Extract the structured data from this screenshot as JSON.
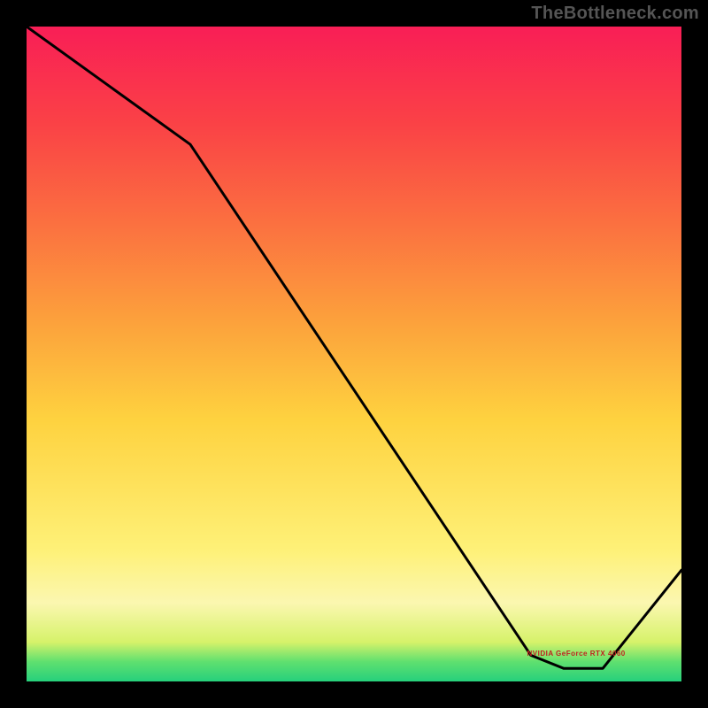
{
  "watermark": "TheBottleneck.com",
  "marker_label": "NVIDIA GeForce RTX 4060",
  "chart_data": {
    "type": "line",
    "title": "",
    "xlabel": "",
    "ylabel": "",
    "xlim": [
      0,
      100
    ],
    "ylim": [
      0,
      100
    ],
    "x": [
      0,
      25,
      77,
      82,
      88,
      100
    ],
    "values": [
      100,
      82,
      4,
      2,
      2,
      17
    ],
    "green_band_y": [
      0,
      3
    ],
    "yellow_white_band_y": [
      3,
      20
    ],
    "marker_x_range": [
      77,
      88
    ],
    "gradient_stops": [
      {
        "pct": 0,
        "color": "#26d07c"
      },
      {
        "pct": 3,
        "color": "#5fe06f"
      },
      {
        "pct": 6,
        "color": "#d6f26a"
      },
      {
        "pct": 12,
        "color": "#fbf7b0"
      },
      {
        "pct": 20,
        "color": "#fef178"
      },
      {
        "pct": 40,
        "color": "#fed23f"
      },
      {
        "pct": 55,
        "color": "#fca13c"
      },
      {
        "pct": 70,
        "color": "#fb7040"
      },
      {
        "pct": 85,
        "color": "#fa4246"
      },
      {
        "pct": 100,
        "color": "#f91e56"
      }
    ]
  }
}
